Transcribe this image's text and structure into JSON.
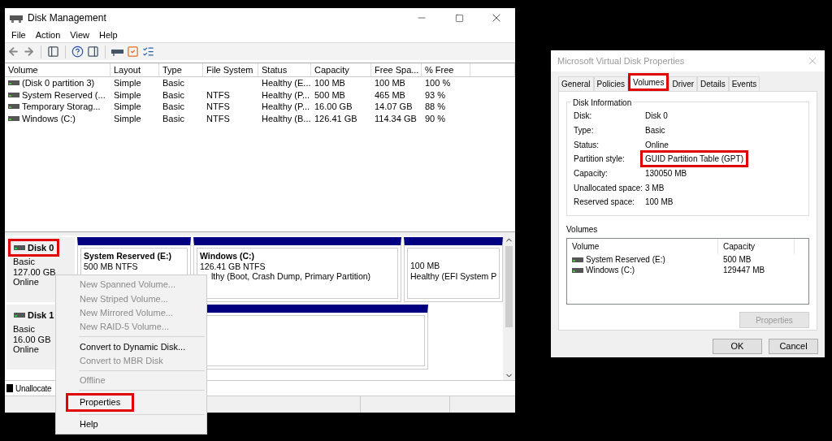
{
  "main_window": {
    "title": "Disk Management",
    "menu": [
      "File",
      "Action",
      "View",
      "Help"
    ],
    "volume_list": {
      "columns": [
        "Volume",
        "Layout",
        "Type",
        "File System",
        "Status",
        "Capacity",
        "Free Spa...",
        "% Free"
      ],
      "rows": [
        {
          "cells": [
            "(Disk 0 partition 3)",
            "Simple",
            "Basic",
            "",
            "Healthy (E...",
            "100 MB",
            "100 MB",
            "100 %"
          ]
        },
        {
          "cells": [
            "System Reserved (...",
            "Simple",
            "Basic",
            "NTFS",
            "Healthy (P...",
            "500 MB",
            "465 MB",
            "93 %"
          ]
        },
        {
          "cells": [
            "Temporary Storag...",
            "Simple",
            "Basic",
            "NTFS",
            "Healthy (P...",
            "16.00 GB",
            "14.07 GB",
            "88 %"
          ]
        },
        {
          "cells": [
            "Windows (C:)",
            "Simple",
            "Basic",
            "NTFS",
            "Healthy (B...",
            "126.41 GB",
            "114.34 GB",
            "90 %"
          ]
        }
      ]
    },
    "disks": [
      {
        "name": "Disk 0",
        "type": "Basic",
        "size": "127.00 GB",
        "status": "Online",
        "highlighted": true,
        "partitions": [
          {
            "kind": "primary",
            "title": "System Reserved  (E:)",
            "lines": [
              {
                "text": "500 MB NTFS"
              }
            ]
          },
          {
            "kind": "primary",
            "title": "Windows  (C:)",
            "lines": [
              {
                "text": "126.41 GB NTFS"
              },
              {
                "text": "lthy (Boot, Crash Dump, Primary Partition)",
                "cut": true
              }
            ]
          },
          {
            "kind": "primary",
            "lines": [
              {
                "text": "100 MB"
              },
              {
                "text": "Healthy (EFI System P"
              }
            ]
          }
        ]
      },
      {
        "name": "Disk 1",
        "type": "Basic",
        "size": "16.00 GB",
        "status": "Online",
        "highlighted": false,
        "partitions": [
          {
            "kind": "primary"
          }
        ]
      }
    ],
    "legend": [
      "Unallocate"
    ]
  },
  "context_menu": [
    {
      "kind": "item",
      "label": "New Spanned Volume...",
      "disabled": true,
      "highlighted": false
    },
    {
      "kind": "item",
      "label": "New Striped Volume...",
      "disabled": true,
      "highlighted": false
    },
    {
      "kind": "item",
      "label": "New Mirrored Volume...",
      "disabled": true,
      "highlighted": false
    },
    {
      "kind": "item",
      "label": "New RAID-5 Volume...",
      "disabled": true,
      "highlighted": false
    },
    {
      "kind": "separator"
    },
    {
      "kind": "item",
      "label": "Convert to Dynamic Disk...",
      "disabled": false,
      "highlighted": false
    },
    {
      "kind": "item",
      "label": "Convert to MBR Disk",
      "disabled": true,
      "highlighted": false
    },
    {
      "kind": "separator"
    },
    {
      "kind": "item",
      "label": "Offline",
      "disabled": true,
      "highlighted": false
    },
    {
      "kind": "separator"
    },
    {
      "kind": "item",
      "label": "Properties",
      "disabled": false,
      "highlighted": true
    },
    {
      "kind": "separator"
    },
    {
      "kind": "item",
      "label": "Help",
      "disabled": false,
      "highlighted": false
    }
  ],
  "properties_dialog": {
    "title": "Microsoft Virtual Disk Properties",
    "tabs": [
      {
        "label": "General",
        "selected": false,
        "highlighted": false
      },
      {
        "label": "Policies",
        "selected": false,
        "highlighted": false
      },
      {
        "label": "Volumes",
        "selected": true,
        "highlighted": true
      },
      {
        "label": "Driver",
        "selected": false,
        "highlighted": false
      },
      {
        "label": "Details",
        "selected": false,
        "highlighted": false
      },
      {
        "label": "Events",
        "selected": false,
        "highlighted": false
      }
    ],
    "disk_information": {
      "title": "Disk Information",
      "fields": [
        {
          "label": "Disk:",
          "value": "Disk 0",
          "highlighted": false
        },
        {
          "label": "Type:",
          "value": "Basic",
          "highlighted": false
        },
        {
          "label": "Status:",
          "value": "Online",
          "highlighted": false
        },
        {
          "label": "Partition style:",
          "value": "GUID Partition Table (GPT)",
          "highlighted": true
        },
        {
          "label": "Capacity:",
          "value": "130050 MB",
          "highlighted": false
        },
        {
          "label": "Unallocated space:",
          "value": "3 MB",
          "highlighted": false
        },
        {
          "label": "Reserved space:",
          "value": "100 MB",
          "highlighted": false
        }
      ]
    },
    "volumes": {
      "title": "Volumes",
      "columns": [
        "Volume",
        "Capacity"
      ],
      "rows": [
        {
          "volume": "System Reserved (E:)",
          "capacity": "500 MB"
        },
        {
          "volume": "Windows (C:)",
          "capacity": "129447 MB"
        }
      ]
    },
    "properties_button": {
      "label": "Properties",
      "disabled": true
    },
    "buttons": [
      "OK",
      "Cancel"
    ]
  }
}
